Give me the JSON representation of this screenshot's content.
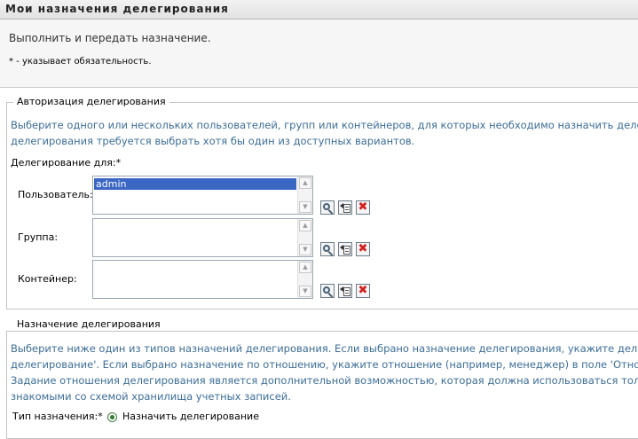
{
  "page": {
    "title": "Мои назначения делегирования",
    "description": "Выполнить и передать назначение.",
    "required_note": "* - указывает обязательность."
  },
  "authorization": {
    "legend": "Авторизация делегирования",
    "help_lines": [
      "Выберите одного или нескольких пользователей, групп или контейнеров, для которых необходимо назначить делег",
      "делегирования требуется выбрать хотя бы один из доступных вариантов."
    ],
    "delegation_for_label": "Делегирование для:*",
    "fields": {
      "user": {
        "label": "Пользователь:",
        "items": [
          "admin"
        ]
      },
      "group": {
        "label": "Группа:",
        "items": []
      },
      "container": {
        "label": "Контейнер:",
        "items": []
      }
    },
    "icons": [
      "search-icon",
      "history-icon",
      "delete-icon"
    ]
  },
  "assignment": {
    "legend": "Назначение делегирования",
    "help_lines": [
      "Выберите ниже один из типов назначений делегирования. Если выбрано назначение делегирования, укажите делег",
      "делегирование'. Если выбрано назначение по отношению, укажите отношение (например, менеджер) в поле 'Отнош",
      "Задание отношения делегирования является дополнительной возможностью, которая должна использоваться тольн",
      "знакомыми со схемой хранилища учетных записей."
    ],
    "type_label": "Тип назначения:*",
    "type_option": "Назначить делегирование"
  },
  "colors": {
    "help_text": "#3d6e97",
    "selection": "#3a66c4",
    "delete": "#d21f1f",
    "radio": "#2e7d2e"
  }
}
